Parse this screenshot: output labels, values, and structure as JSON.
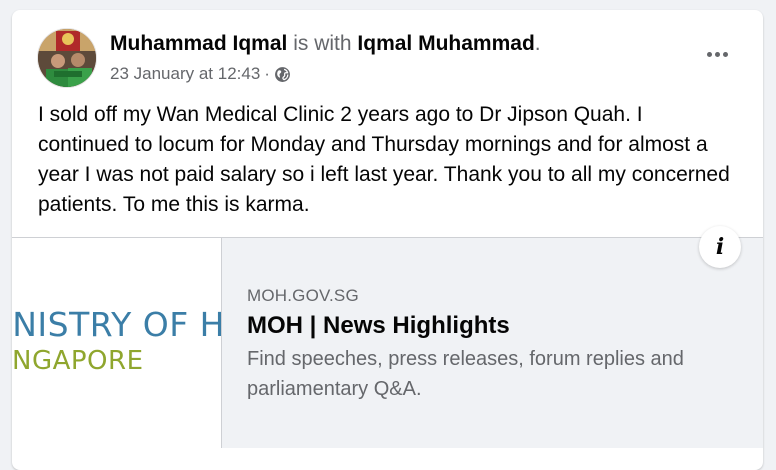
{
  "post": {
    "author": "Muhammad Iqmal",
    "with_text": "is with",
    "tagged_user": "Iqmal Muhammad",
    "tagged_suffix": ".",
    "timestamp": "23 January at 12:43",
    "separator": "·",
    "audience_icon": "globe-icon",
    "more_icon": "more-options-icon",
    "text": "I sold off my Wan Medical Clinic 2 years ago to Dr Jipson Quah. I continued to locum for Monday and Thursday mornings and for almost a year I was not paid salary so i left last year. Thank you to all my concerned patients. To me this is karma."
  },
  "link_preview": {
    "thumbnail_line1": "INISTRY OF H",
    "thumbnail_line2": "NGAPORE",
    "domain": "MOH.GOV.SG",
    "title": "MOH | News Highlights",
    "description": "Find speeches, press releases, forum replies and parliamentary Q&A.",
    "info_icon": "info-icon",
    "info_glyph": "i"
  },
  "colors": {
    "text_primary": "#050505",
    "text_secondary": "#65676b",
    "card_bg": "#ffffff",
    "page_bg": "#f0f2f5",
    "thumb_blue": "#3b7ea7",
    "thumb_green": "#8fa62e"
  }
}
